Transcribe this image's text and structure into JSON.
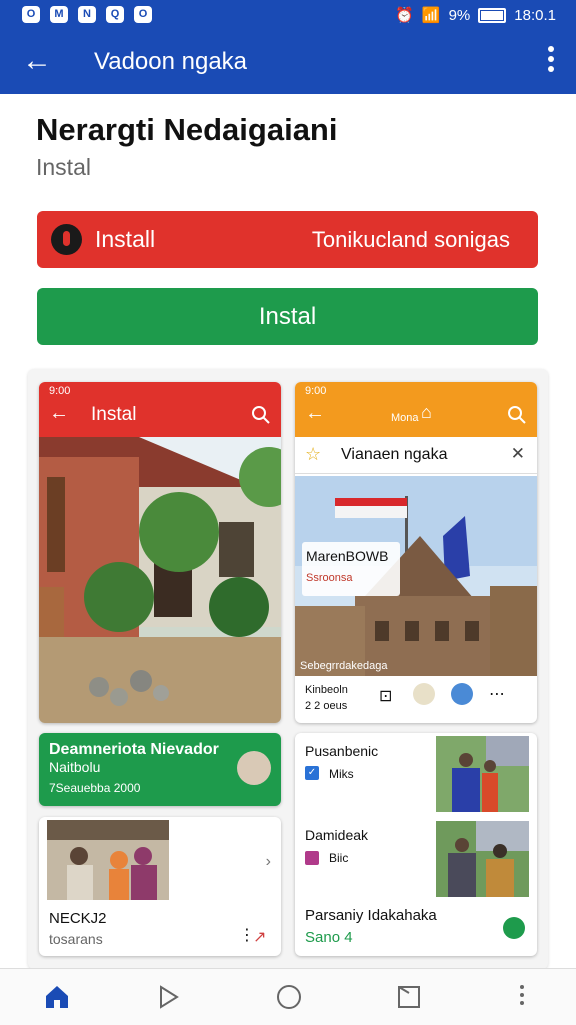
{
  "status_bar": {
    "battery": "9%",
    "time": "18:0.1",
    "app_icons": [
      "O",
      "M",
      "N",
      "Q",
      "O"
    ]
  },
  "app_bar": {
    "back_icon": "arrow-left-icon",
    "title": "Vadoon ngaka",
    "menu_icon": "more-vert-icon"
  },
  "header": {
    "title": "Nerargti Nedaigaiani",
    "subtitle": "Instal"
  },
  "actions": {
    "red_button": {
      "label": "Install",
      "secondary": "Tonikucland sonigas"
    },
    "green_button": {
      "label": "Instal"
    }
  },
  "screens": {
    "left": {
      "status": "9:00",
      "bar_title": "Instal"
    },
    "right": {
      "status": "9:00",
      "bar_title": "Mona",
      "search_row": "Vianaen ngaka",
      "image_caption_title": "MarenBOWB",
      "image_caption_sub": "Ssroonsa",
      "image_footer": "Sebegrrdakedaga",
      "info_title": "Kinbeoln",
      "info_sub": "2 2 oeus"
    }
  },
  "cards": {
    "green": {
      "title": "Deamneriota Nievador",
      "line2": "Naitbolu",
      "line3": "7Seauebba 2000"
    },
    "bottom_left": {
      "title": "NECKJ2",
      "subtitle": "tosarans"
    },
    "list": [
      {
        "title": "Pusanbenic",
        "sub": "Miks"
      },
      {
        "title": "Damideak",
        "sub": "Biic"
      }
    ],
    "footer": {
      "title": "Parsaniy Idakahaka",
      "price": "Sano",
      "price_suffix": "4"
    }
  },
  "colors": {
    "primary": "#1a4bb5",
    "red": "#e0322c",
    "green": "#1e9b4c",
    "orange": "#f39a1e"
  }
}
